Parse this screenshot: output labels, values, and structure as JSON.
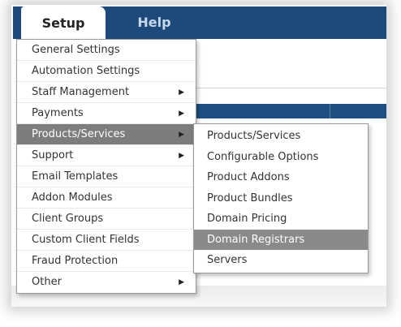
{
  "tabs": {
    "setup": "Setup",
    "help": "Help"
  },
  "menu": {
    "items": [
      {
        "label": "General Settings",
        "submenu": false
      },
      {
        "label": "Automation Settings",
        "submenu": false
      },
      {
        "label": "Staff Management",
        "submenu": true
      },
      {
        "label": "Payments",
        "submenu": true
      },
      {
        "label": "Products/Services",
        "submenu": true,
        "active": true
      },
      {
        "label": "Support",
        "submenu": true
      },
      {
        "label": "Email Templates",
        "submenu": false
      },
      {
        "label": "Addon Modules",
        "submenu": false
      },
      {
        "label": "Client Groups",
        "submenu": false
      },
      {
        "label": "Custom Client Fields",
        "submenu": false
      },
      {
        "label": "Fraud Protection",
        "submenu": false
      },
      {
        "label": "Other",
        "submenu": true
      }
    ]
  },
  "submenu": {
    "items": [
      {
        "label": "Products/Services"
      },
      {
        "label": "Configurable Options"
      },
      {
        "label": "Product Addons"
      },
      {
        "label": "Product Bundles"
      },
      {
        "label": "Domain Pricing"
      },
      {
        "label": "Domain Registrars",
        "active": true
      },
      {
        "label": "Servers"
      }
    ]
  },
  "colors": {
    "nav_bar": "#1d4a7a",
    "highlight": "#7d7d7d"
  },
  "icons": {
    "submenu_arrow": "triangle-right-icon"
  }
}
